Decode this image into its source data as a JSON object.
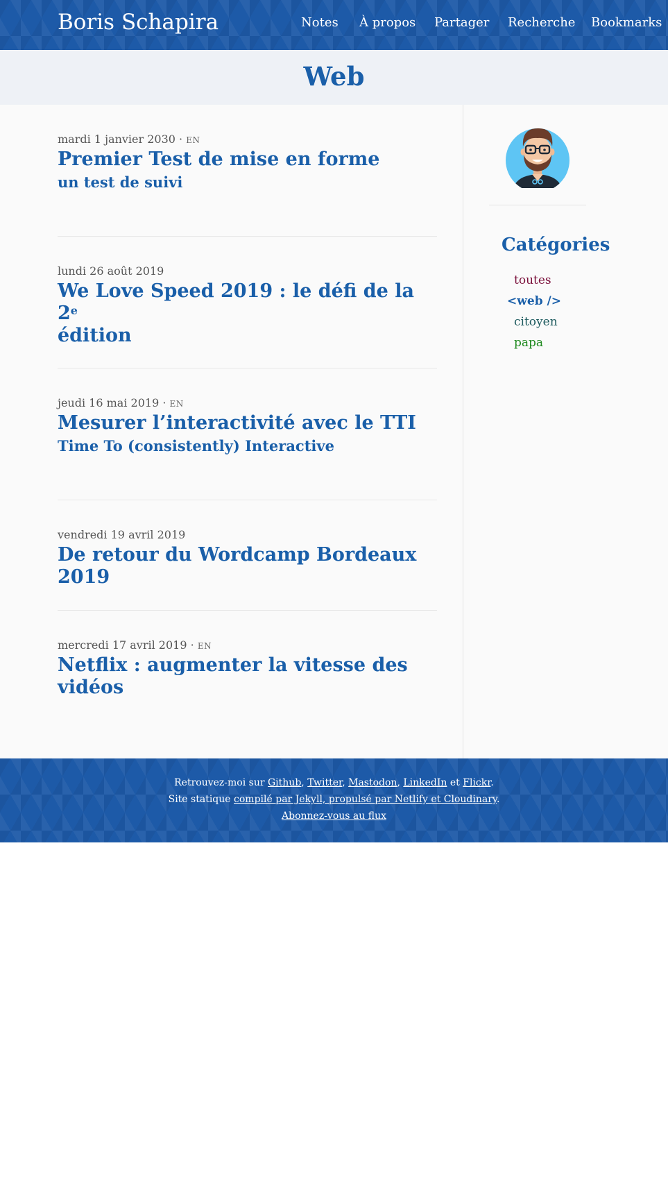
{
  "header": {
    "site_title": "Boris Schapira",
    "nav": [
      "Notes",
      "À propos",
      "Partager",
      "Recherche",
      "Bookmarks"
    ]
  },
  "page": {
    "title": "Web"
  },
  "posts": [
    {
      "date": "mardi 1 janvier 2030",
      "lang": "EN",
      "title": "Premier Test de mise en forme",
      "subtitle": "un test de suivi"
    },
    {
      "date": "lundi 26 août 2019",
      "lang": "",
      "title_main": "We Love Speed 2019 : le défi de la 2",
      "title_sup": "e",
      "title_rest": " édition"
    },
    {
      "date": "jeudi 16 mai 2019",
      "lang": "EN",
      "title": "Mesurer l’interactivité avec le TTI",
      "subtitle": "Time To (consistently) Interactive"
    },
    {
      "date": "vendredi 19 avril 2019",
      "lang": "",
      "title": "De retour du Wordcamp Bordeaux 2019"
    },
    {
      "date": "mercredi 17 avril 2019",
      "lang": "EN",
      "title": "Netflix : augmenter la vitesse des vidéos"
    }
  ],
  "lang_separator": "·",
  "sidebar": {
    "categories_title": "Catégories",
    "categories": [
      {
        "label": "toutes",
        "color": "#7a0f3a",
        "active": false
      },
      {
        "label": "<web />",
        "color": "#1a5fa9",
        "active": true
      },
      {
        "label": "citoyen",
        "color": "#1d5a5e",
        "active": false
      },
      {
        "label": "papa",
        "color": "#1f8a1f",
        "active": false
      }
    ]
  },
  "footer": {
    "line1_prefix": "Retrouvez-moi sur",
    "links": [
      "Github",
      "Twitter",
      "Mastodon",
      "LinkedIn",
      "Flickr"
    ],
    "and_word": "et",
    "line2_prefix": "Site statique",
    "line2_link": "compilé par Jekyll, propulsé par Netlify et Cloudinary",
    "feed_link": "Abonnez-vous au flux"
  },
  "colors": {
    "brand": "#1d5aa8",
    "title_blue": "#1a5fa9",
    "banner_bg": "#eef1f6",
    "main_bg": "#fafafa"
  }
}
